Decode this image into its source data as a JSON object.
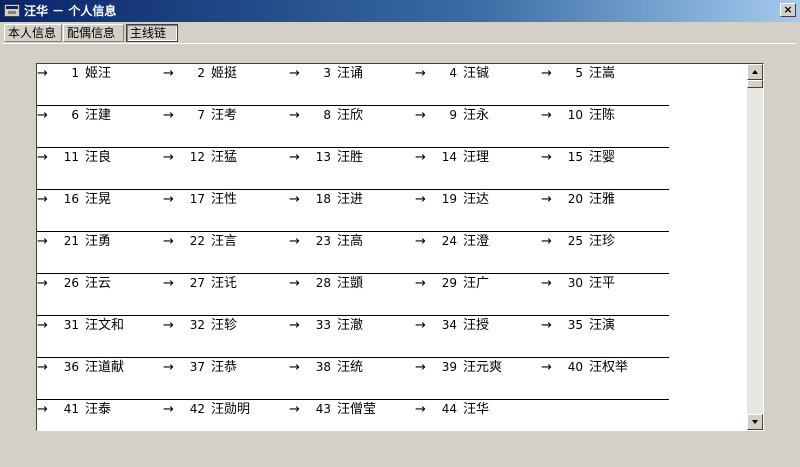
{
  "window": {
    "title": "汪华 － 个人信息",
    "close_label": "×"
  },
  "tabs": [
    {
      "label": "本人信息"
    },
    {
      "label": "配偶信息"
    },
    {
      "label": "主线链"
    }
  ],
  "chain": {
    "arrow": "→",
    "entries": [
      {
        "num": "1",
        "name": "姬汪"
      },
      {
        "num": "2",
        "name": "姬挺"
      },
      {
        "num": "3",
        "name": "汪诵"
      },
      {
        "num": "4",
        "name": "汪铖"
      },
      {
        "num": "5",
        "name": "汪嵩"
      },
      {
        "num": "6",
        "name": "汪建"
      },
      {
        "num": "7",
        "name": "汪考"
      },
      {
        "num": "8",
        "name": "汪欣"
      },
      {
        "num": "9",
        "name": "汪永"
      },
      {
        "num": "10",
        "name": "汪陈"
      },
      {
        "num": "11",
        "name": "汪良"
      },
      {
        "num": "12",
        "name": "汪猛"
      },
      {
        "num": "13",
        "name": "汪胜"
      },
      {
        "num": "14",
        "name": "汪理"
      },
      {
        "num": "15",
        "name": "汪婴"
      },
      {
        "num": "16",
        "name": "汪晃"
      },
      {
        "num": "17",
        "name": "汪性"
      },
      {
        "num": "18",
        "name": "汪进"
      },
      {
        "num": "19",
        "name": "汪达"
      },
      {
        "num": "20",
        "name": "汪雅"
      },
      {
        "num": "21",
        "name": "汪勇"
      },
      {
        "num": "22",
        "name": "汪言"
      },
      {
        "num": "23",
        "name": "汪高"
      },
      {
        "num": "24",
        "name": "汪澄"
      },
      {
        "num": "25",
        "name": "汪珍"
      },
      {
        "num": "26",
        "name": "汪云"
      },
      {
        "num": "27",
        "name": "汪讬"
      },
      {
        "num": "28",
        "name": "汪顗"
      },
      {
        "num": "29",
        "name": "汪广"
      },
      {
        "num": "30",
        "name": "汪平"
      },
      {
        "num": "31",
        "name": "汪文和"
      },
      {
        "num": "32",
        "name": "汪轸"
      },
      {
        "num": "33",
        "name": "汪澈"
      },
      {
        "num": "34",
        "name": "汪授"
      },
      {
        "num": "35",
        "name": "汪演"
      },
      {
        "num": "36",
        "name": "汪道献"
      },
      {
        "num": "37",
        "name": "汪恭"
      },
      {
        "num": "38",
        "name": "汪统"
      },
      {
        "num": "39",
        "name": "汪元爽"
      },
      {
        "num": "40",
        "name": "汪权举"
      },
      {
        "num": "41",
        "name": "汪泰"
      },
      {
        "num": "42",
        "name": "汪勋明"
      },
      {
        "num": "43",
        "name": "汪僧莹"
      },
      {
        "num": "44",
        "name": "汪华"
      }
    ]
  }
}
